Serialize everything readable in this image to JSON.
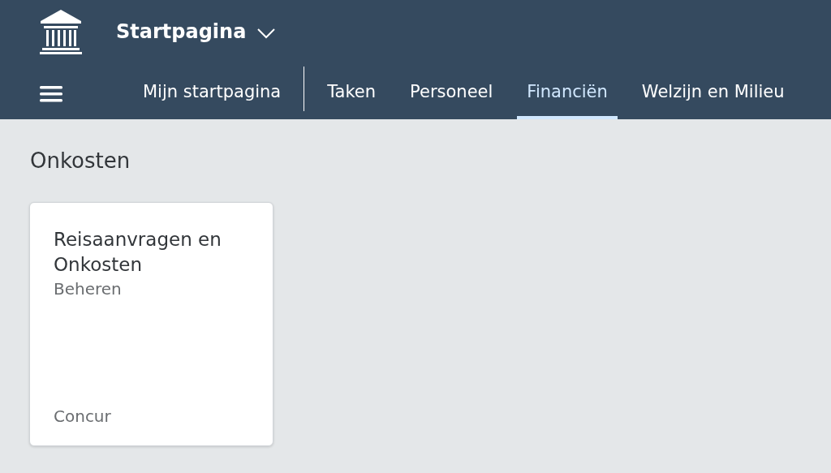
{
  "shell": {
    "title": "Startpagina"
  },
  "tabs": [
    {
      "label": "Mijn startpagina",
      "selected": false
    },
    {
      "label": "Taken",
      "selected": false
    },
    {
      "label": "Personeel",
      "selected": false
    },
    {
      "label": "Financiën",
      "selected": true
    },
    {
      "label": "Welzijn en Milieu",
      "selected": false
    }
  ],
  "section": {
    "title": "Onkosten"
  },
  "tiles": [
    {
      "title": "Reisaanvragen en Onkosten",
      "subtitle": "Beheren",
      "footer": "Concur"
    }
  ]
}
